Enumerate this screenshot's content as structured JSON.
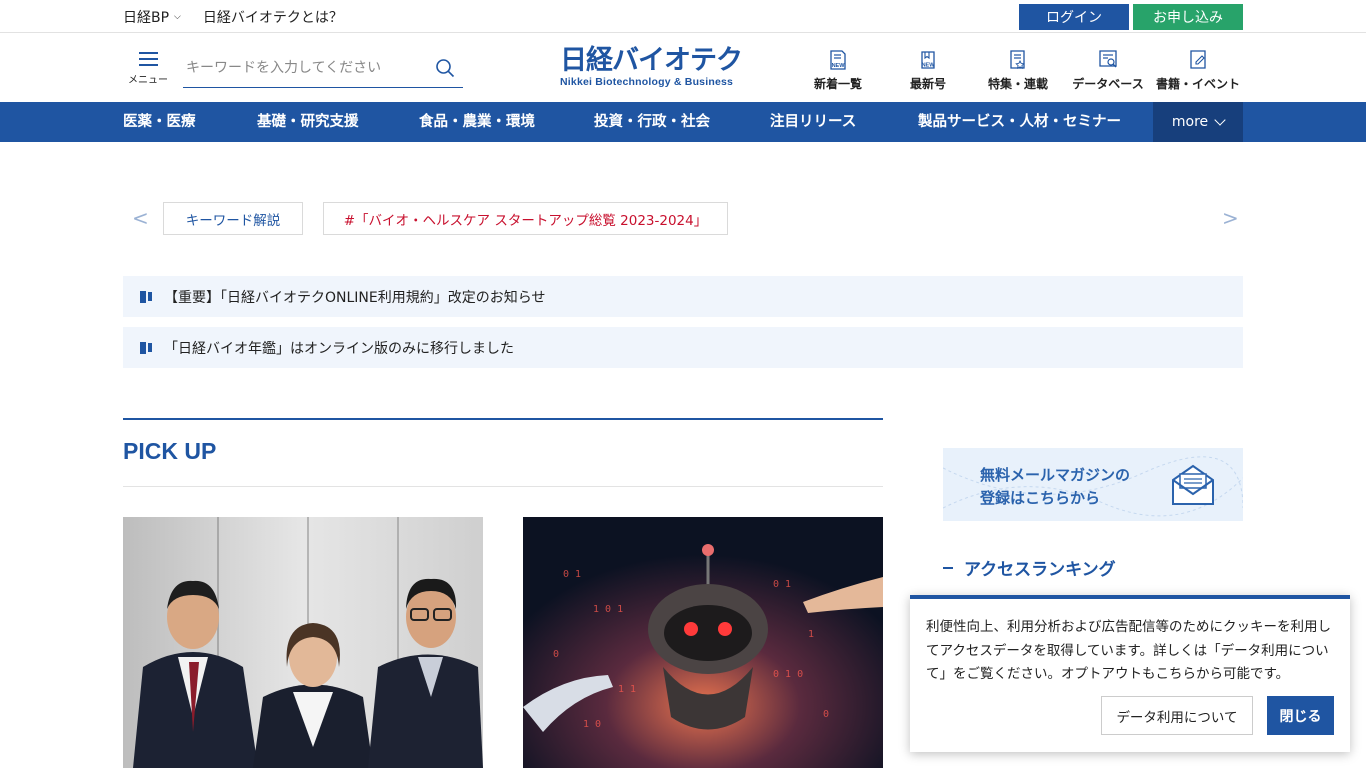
{
  "topbar": {
    "nikkei_bp": "日経BP",
    "about": "日経バイオテクとは？",
    "login": "ログイン",
    "apply": "お申し込み"
  },
  "header": {
    "menu_label": "メニュー",
    "search_placeholder": "キーワードを入力してください",
    "logo_jp": "日経バイオテク",
    "logo_en": "Nikkei Biotechnology & Business",
    "nav": [
      {
        "label": "新着一覧",
        "icon": "new-list-icon"
      },
      {
        "label": "最新号",
        "icon": "latest-issue-icon"
      },
      {
        "label": "特集・連載",
        "icon": "feature-icon"
      },
      {
        "label": "データベース",
        "icon": "database-icon"
      },
      {
        "label": "書籍・イベント",
        "icon": "books-events-icon"
      }
    ]
  },
  "nav": {
    "items": [
      "医薬・医療",
      "基礎・研究支援",
      "食品・農業・環境",
      "投資・行政・社会",
      "注目リリース",
      "製品サービス・人材・セミナー"
    ],
    "more": "more"
  },
  "keywords": {
    "prev": "<",
    "next": ">",
    "items": [
      "キーワード解説",
      "#「バイオ・ヘルスケア スタートアップ総覧 2023-2024」"
    ]
  },
  "notices": [
    "【重要】「日経バイオテクONLINE利用規約」改定のお知らせ",
    "「日経バイオ年鑑」はオンライン版のみに移行しました"
  ],
  "pickup": {
    "title": "PICK UP"
  },
  "sidebar": {
    "mail_line1": "無料メールマガジンの",
    "mail_line2": "登録はこちらから",
    "ranking_title": "アクセスランキング"
  },
  "cookie": {
    "message": "利便性向上、利用分析および広告配信等のためにクッキーを利用してアクセスデータを取得しています。詳しくは「データ利用について」をご覧ください。オプトアウトもこちらから可能です。",
    "data_button": "データ利用について",
    "close_button": "閉じる"
  },
  "colors": {
    "brand": "#1f55a2",
    "apply_green": "#28a36a",
    "keyword_red": "#c8102e",
    "notice_bg": "#f0f5fc"
  }
}
